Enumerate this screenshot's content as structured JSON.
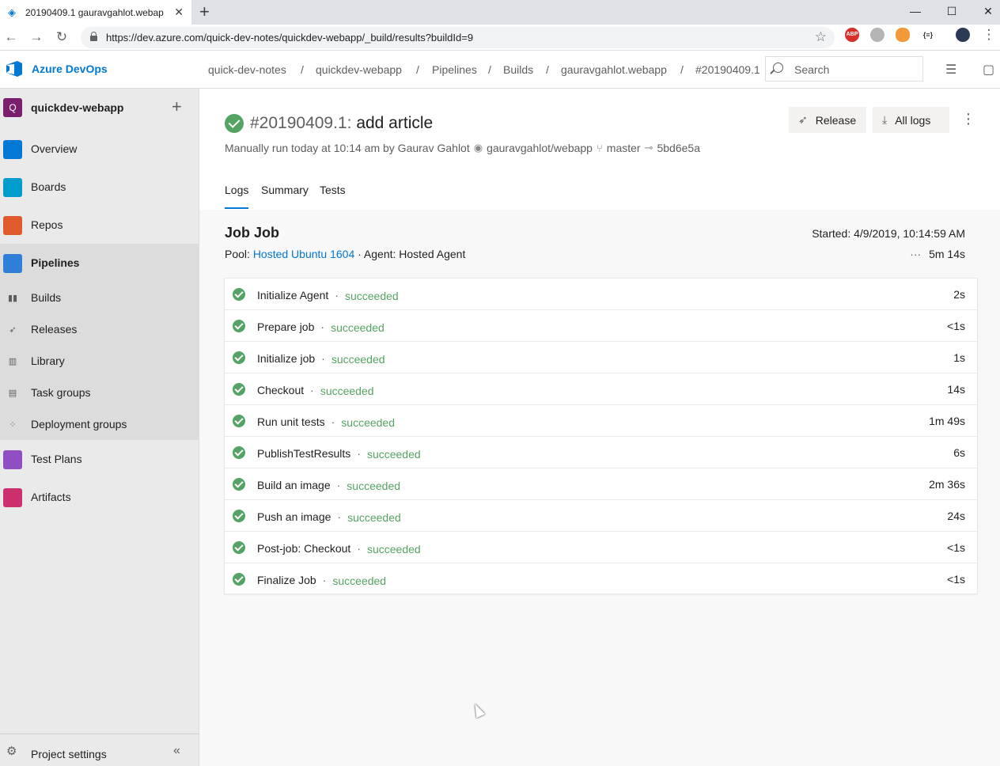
{
  "browser": {
    "tab_title": "20190409.1 gauravgahlot.webapp",
    "tab_close": "✕",
    "new_tab": "+",
    "url": "https://dev.azure.com/quick-dev-notes/quickdev-webapp/_build/results?buildId=9",
    "window_controls": [
      "—",
      "☐",
      "✕"
    ],
    "extensions": [
      "ABP",
      "",
      "",
      "{≡}",
      ""
    ]
  },
  "header": {
    "brand": "Azure DevOps",
    "breadcrumbs": [
      "quick-dev-notes",
      "quickdev-webapp",
      "Pipelines",
      "Builds",
      "gauravgahlot.webapp",
      "#20190409.1"
    ],
    "separator": "/",
    "search_placeholder": "Search"
  },
  "sidebar": {
    "project_initial": "Q",
    "project_name": "quickdev-webapp",
    "add": "+",
    "items": [
      {
        "label": "Overview",
        "icon": "overview-icon",
        "color": "#0078d4"
      },
      {
        "label": "Boards",
        "icon": "boards-icon",
        "color": "#009ccc"
      },
      {
        "label": "Repos",
        "icon": "repos-icon",
        "color": "#e05b2b"
      },
      {
        "label": "Pipelines",
        "icon": "pipelines-icon",
        "color": "#2f7fd8"
      }
    ],
    "sub_items": [
      {
        "label": "Builds",
        "icon": "builds-icon"
      },
      {
        "label": "Releases",
        "icon": "releases-icon"
      },
      {
        "label": "Library",
        "icon": "library-icon"
      },
      {
        "label": "Task groups",
        "icon": "task-groups-icon"
      },
      {
        "label": "Deployment groups",
        "icon": "deployment-groups-icon"
      }
    ],
    "items_after": [
      {
        "label": "Test Plans",
        "icon": "test-plans-icon",
        "color": "#8f4ec2"
      },
      {
        "label": "Artifacts",
        "icon": "artifacts-icon",
        "color": "#cc2f6e"
      }
    ],
    "project_settings": "Project settings",
    "collapse": "«"
  },
  "build": {
    "number": "#20190409.1:",
    "name": "add article",
    "meta": {
      "run_text": "Manually run today at 10:14 am by Gaurav Gahlot",
      "repo": "gauravgahlot/webapp",
      "branch": "master",
      "commit": "5bd6e5a"
    },
    "release_label": "Release",
    "all_logs_label": "All logs",
    "more": "⋮",
    "tabs": [
      "Logs",
      "Summary",
      "Tests"
    ],
    "active_tab": "Logs"
  },
  "job": {
    "title": "Job Job",
    "started": "Started: 4/9/2019, 10:14:59 AM",
    "pool_label": "Pool:",
    "pool_link": "Hosted Ubuntu 1604",
    "agent": "· Agent: Hosted Agent",
    "duration_dots": "···",
    "duration": "5m 14s",
    "steps": [
      {
        "name": "Initialize Agent",
        "status": "succeeded",
        "duration": "2s"
      },
      {
        "name": "Prepare job",
        "status": "succeeded",
        "duration": "<1s"
      },
      {
        "name": "Initialize job",
        "status": "succeeded",
        "duration": "1s"
      },
      {
        "name": "Checkout",
        "status": "succeeded",
        "duration": "14s"
      },
      {
        "name": "Run unit tests",
        "status": "succeeded",
        "duration": "1m 49s"
      },
      {
        "name": "PublishTestResults",
        "status": "succeeded",
        "duration": "6s"
      },
      {
        "name": "Build an image",
        "status": "succeeded",
        "duration": "2m 36s"
      },
      {
        "name": "Push an image",
        "status": "succeeded",
        "duration": "24s"
      },
      {
        "name": "Post-job: Checkout",
        "status": "succeeded",
        "duration": "<1s"
      },
      {
        "name": "Finalize Job",
        "status": "succeeded",
        "duration": "<1s"
      }
    ]
  },
  "colors": {
    "accent": "#0078d4",
    "success": "#55a362",
    "sidebar_bg": "#eaeaea"
  }
}
